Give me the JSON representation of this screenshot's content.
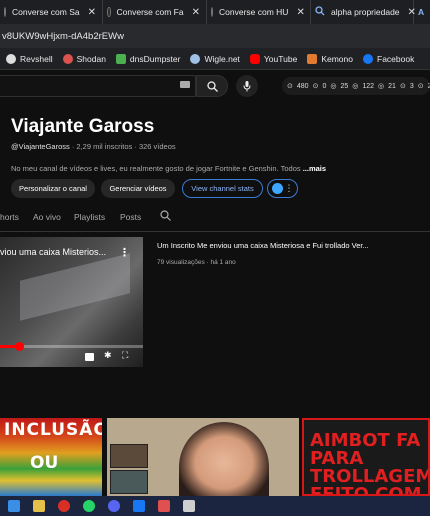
{
  "browser": {
    "tabs": [
      {
        "label": "Converse com Sa",
        "icon": "youtube-icon"
      },
      {
        "label": "Converse com Fa",
        "icon": "youtube-icon"
      },
      {
        "label": "Converse com HU",
        "icon": "youtube-icon"
      },
      {
        "label": "alpha propriedade",
        "icon": "search-icon"
      },
      {
        "label": "A",
        "icon": "app-icon"
      }
    ],
    "close_glyph": "✕",
    "address": "v8UKW9wHjxm-dA4b2rEWw",
    "bookmarks": [
      {
        "label": "Revshell",
        "color": "#dddddd"
      },
      {
        "label": "Shodan",
        "color": "#d9534f"
      },
      {
        "label": "dnsDumpster",
        "color": "#4caf50"
      },
      {
        "label": "Wigle.net",
        "color": "#9ec1e6"
      },
      {
        "label": "YouTube",
        "color": "#ff0000"
      },
      {
        "label": "Kemono",
        "color": "#e07b30"
      },
      {
        "label": "Facebook",
        "color": "#1877f2"
      }
    ]
  },
  "extension_stats": [
    "480",
    "0",
    "25",
    "122",
    "21",
    "3",
    "2"
  ],
  "channel": {
    "name": "Viajante Gaross",
    "handle": "@ViajanteGaross",
    "subscribers": " · 2,29 mil inscritos · 326 vídeos",
    "description": "No meu canal de vídeos e lives, eu realmente gosto de jogar Fortnite e Genshin. Todos ",
    "more": "...mais",
    "buttons": {
      "customize": "Personalizar o canal",
      "manage": "Gerenciar vídeos",
      "stats": "View channel stats"
    },
    "tabs": [
      "horts",
      "Ao vivo",
      "Playlists",
      "Posts"
    ]
  },
  "featured_video": {
    "overlay_title": "viou uma caixa Misterios...",
    "title": "Um Inscrito Me enviou uma caixa Misteriosa e Fui trollado Ver...",
    "meta": "79 visualizações · há 1 ano",
    "progress": 0.13
  },
  "thumbnails": [
    {
      "line1": "INCLUSÃO",
      "line2": "OU"
    },
    {
      "caption": ""
    },
    {
      "lines": [
        "AIMBOT FA",
        "PARA",
        "TROLLAGEM",
        "FEITO COM"
      ]
    }
  ],
  "colors": {
    "accent": "#3ea6ff",
    "progress_red": "#ff0000",
    "background": "#0f0f0f"
  },
  "taskbar_icons": [
    "windows-icon",
    "file-explorer-icon",
    "chrome-icon",
    "whatsapp-icon",
    "discord-icon",
    "facebook-icon",
    "dev-tool-icon",
    "calculator-icon"
  ]
}
